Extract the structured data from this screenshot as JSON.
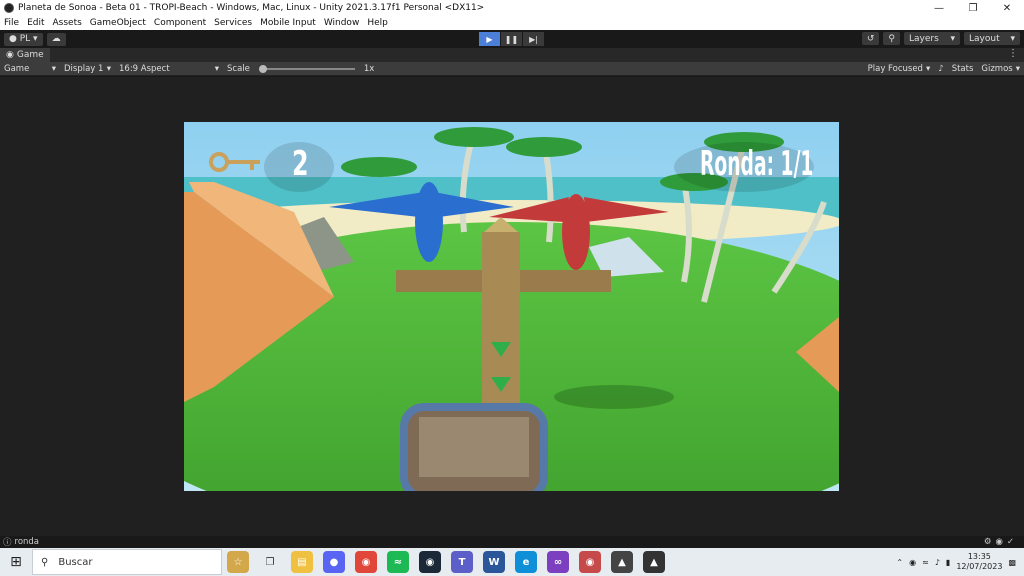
{
  "window": {
    "title": "Planeta de Sonoa - Beta 01 - TROPI-Beach - Windows, Mac, Linux - Unity 2021.3.17f1 Personal <DX11>"
  },
  "menu": [
    "File",
    "Edit",
    "Assets",
    "GameObject",
    "Component",
    "Services",
    "Mobile Input",
    "Window",
    "Help"
  ],
  "toolbar": {
    "account_label": "PL",
    "layers_label": "Layers",
    "layout_label": "Layout"
  },
  "tab": {
    "label": "Game"
  },
  "gamebar": {
    "mode": "Game",
    "display": "Display 1",
    "aspect": "16:9 Aspect",
    "scale_label": "Scale",
    "scale_value": "1x",
    "play_focused": "Play Focused",
    "stats": "Stats",
    "gizmos": "Gizmos"
  },
  "game_hud": {
    "score": "2",
    "round": "Ronda: 1/1"
  },
  "status": {
    "message": "ronda"
  },
  "taskbar": {
    "search_placeholder": "Buscar",
    "time": "13:35",
    "date": "12/07/2023"
  },
  "colors": {
    "play_active": "#4c7fd8",
    "sky": "#7fc6ea",
    "grass": "#4fb83a"
  }
}
